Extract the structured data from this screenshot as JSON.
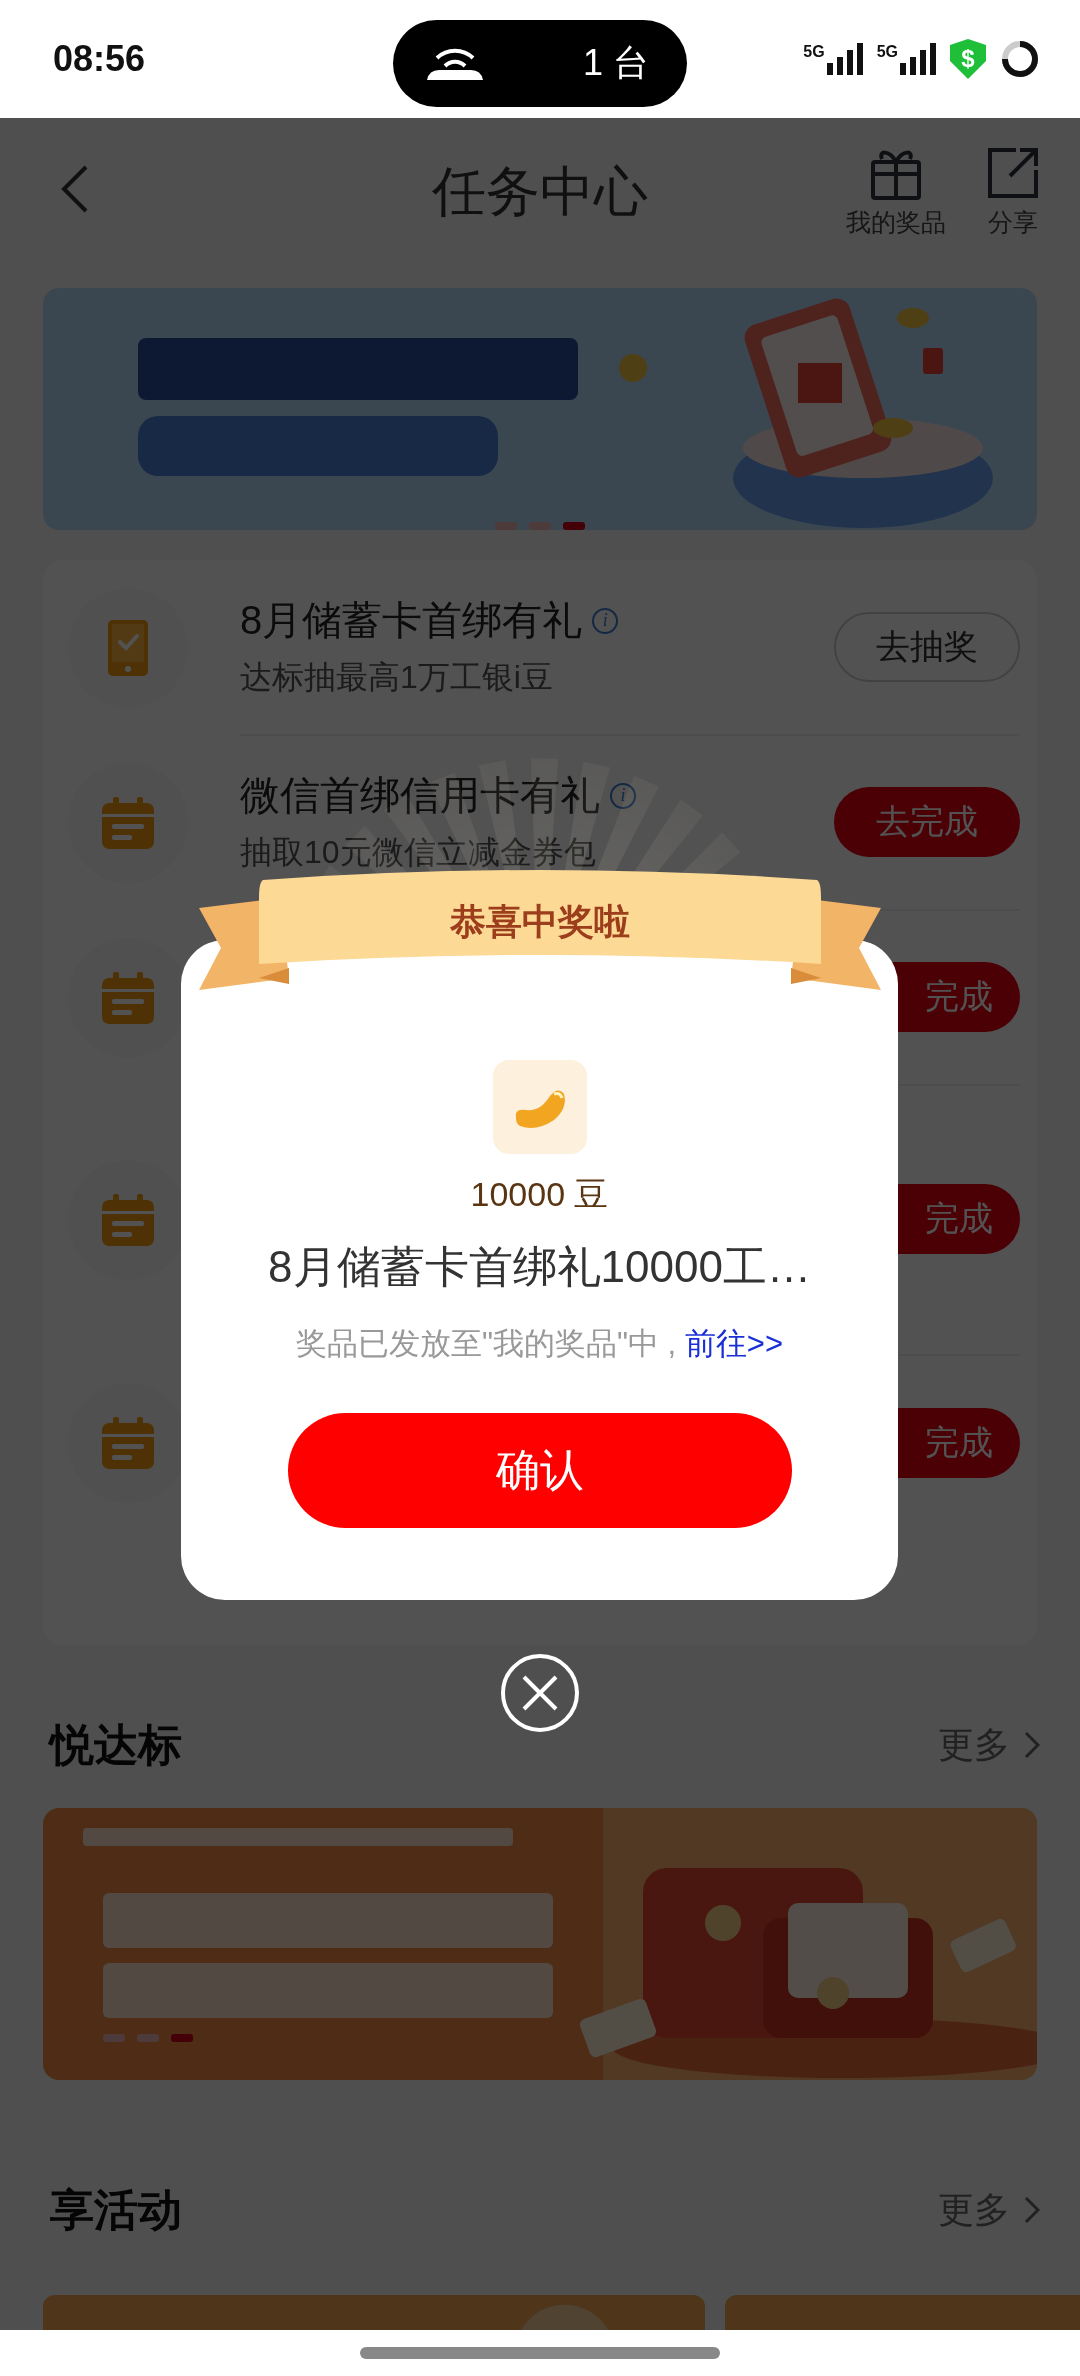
{
  "status_bar": {
    "time": "08:56",
    "island_text": "1 台",
    "network_labels": [
      "5G",
      "5G"
    ],
    "shield_symbol": "$"
  },
  "header": {
    "title": "任务中心",
    "actions": [
      {
        "kind": "gift",
        "label": "我的奖品"
      },
      {
        "kind": "share",
        "label": "分享"
      }
    ]
  },
  "top_banner": {
    "kind": "picture",
    "dots": [
      {
        "selected": false
      },
      {
        "selected": false
      },
      {
        "selected": true
      }
    ]
  },
  "tasks": [
    {
      "kind": "phone",
      "title": "8月储蓄卡首绑有礼",
      "info_icon": "i",
      "subtitle": "达标抽最高1万工银i豆",
      "button": "去抽奖",
      "button_highlighted": false
    },
    {
      "kind": "calendar",
      "title": "微信首绑信用卡有礼",
      "info_icon": "i",
      "subtitle": "抽取10元微信立减金券包",
      "button": "去完成",
      "button_highlighted": true
    },
    {
      "kind": "calendar",
      "button": "完成",
      "button_highlighted": true
    },
    {
      "kind": "calendar",
      "button": "完成",
      "button_highlighted": true
    },
    {
      "kind": "calendar",
      "button": "完成",
      "button_highlighted": true
    }
  ],
  "sections": [
    {
      "title": "悦达标",
      "more": "更多",
      "banner": {
        "kind": "picture",
        "dots": [
          {
            "selected": false
          },
          {
            "selected": false
          },
          {
            "selected": true
          }
        ]
      }
    },
    {
      "title": "享活动",
      "more": "更多"
    }
  ],
  "dialog": {
    "ribbon_title": "恭喜中奖啦",
    "amount": "10000 豆",
    "prize_name": "8月储蓄卡首绑礼10000工…",
    "notice": "奖品已发放至\"我的奖品\"中 ,",
    "link": "前往>>",
    "confirm": "确认"
  }
}
